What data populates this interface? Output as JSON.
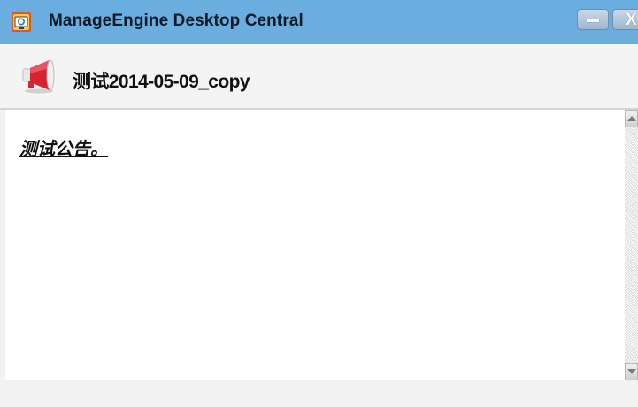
{
  "window": {
    "title": "ManageEngine Desktop Central",
    "app_icon": "manageengine-app-icon",
    "minimize_glyph": "—",
    "close_glyph": "X"
  },
  "announcement": {
    "icon": "megaphone-icon",
    "title": "测试2014-05-09_copy",
    "body": "测试公告。"
  },
  "scrollbar": {
    "up_icon": "scroll-up-arrow-icon",
    "down_icon": "scroll-down-arrow-icon"
  },
  "colors": {
    "titlebar": "#6aaee0",
    "megaphone_red": "#d6232f",
    "background": "#f2f2f2"
  }
}
